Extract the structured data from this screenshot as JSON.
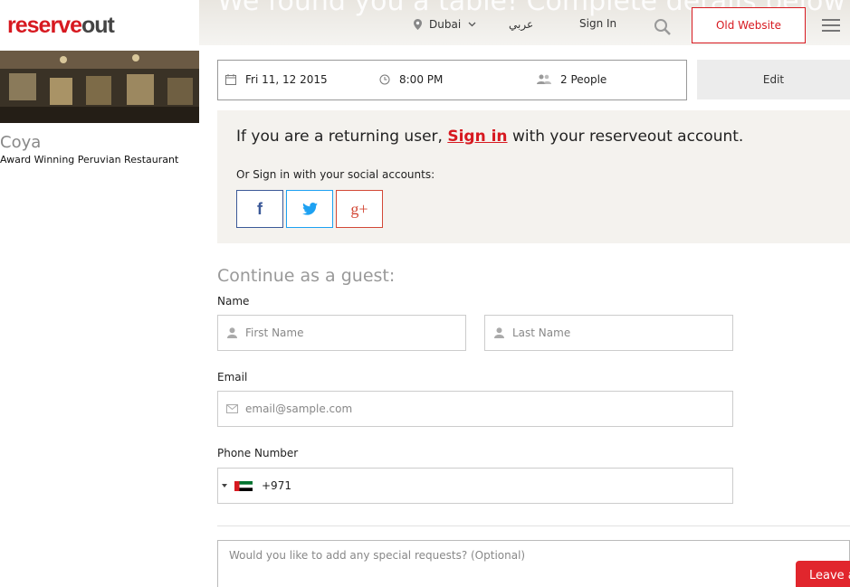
{
  "header": {
    "hero_text": "We found you a table! Complete details below",
    "logo_red": "reserve",
    "logo_grey": "out",
    "city": "Dubai",
    "language": "عربي",
    "sign_in": "Sign In",
    "old_website": "Old Website"
  },
  "restaurant": {
    "name": "Coya",
    "description": "Award Winning Peruvian Restaurant"
  },
  "booking": {
    "date": "Fri 11, 12 2015",
    "time": "8:00 PM",
    "people": "2 People",
    "edit": "Edit"
  },
  "signin": {
    "prefix": "If you are a returning user,",
    "link": "Sign in",
    "suffix": "with your reserveout account.",
    "social_label": "Or Sign in with your social accounts:",
    "facebook": "f",
    "google": "g+"
  },
  "guest": {
    "title": "Continue as a guest:",
    "name_label": "Name",
    "first_placeholder": "First Name",
    "last_placeholder": "Last Name",
    "email_label": "Email",
    "email_placeholder": "email@sample.com",
    "phone_label": "Phone Number",
    "phone_code": "+971",
    "requests_placeholder": "Would you like to add any special requests? (Optional)"
  },
  "feedback": {
    "label": "Leave a"
  },
  "colors": {
    "brand_red": "#d71920",
    "facebook": "#3b5998",
    "twitter": "#1da1f2",
    "google": "#d34836"
  }
}
